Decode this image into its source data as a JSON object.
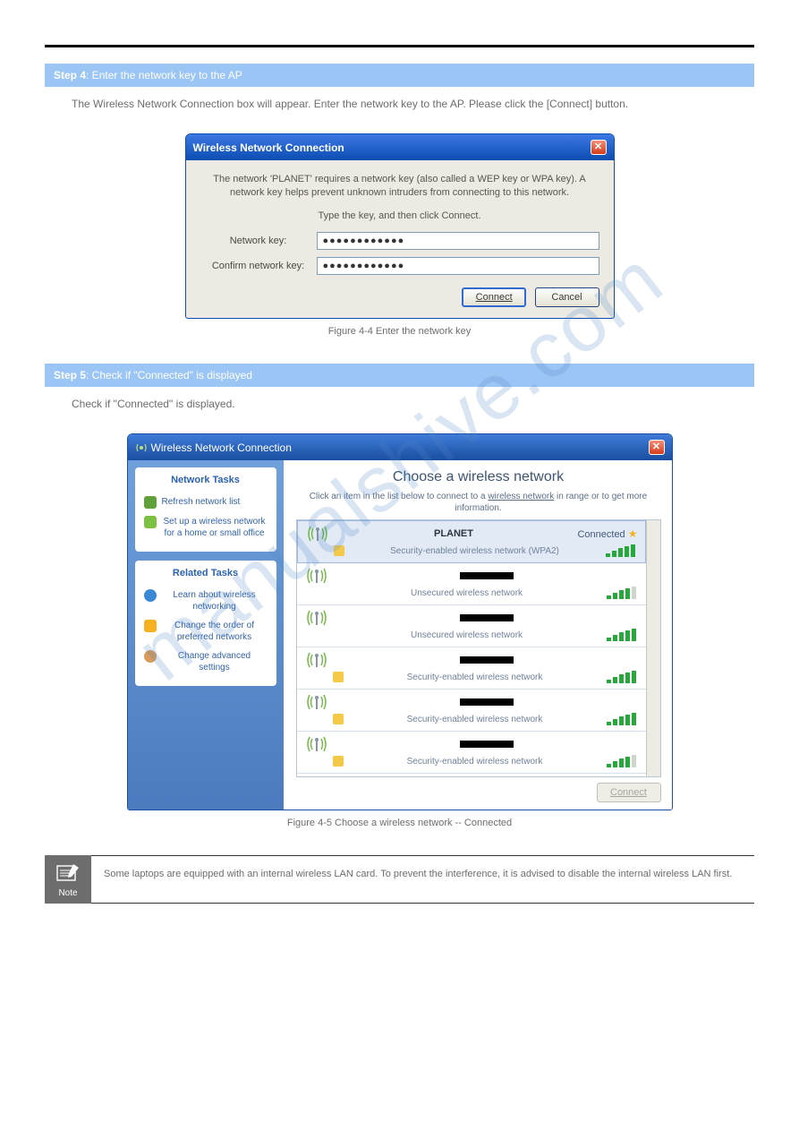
{
  "watermark": "manualshive.com",
  "step4": {
    "header_strong": "Step 4",
    "header_rest": ": Enter the network key to the AP",
    "body": "The Wireless Network Connection box will appear. Enter the network key to the AP. Please click the [Connect] button."
  },
  "fig1_caption": "Figure 4-4 Enter the network key",
  "step5": {
    "header_strong": "Step 5",
    "header_rest": ": Check if \"Connected\" is displayed",
    "body": "Check if \"Connected\" is displayed."
  },
  "fig2_caption": "Figure 4-5 Choose a wireless network -- Connected",
  "dialog1": {
    "title": "Wireless Network Connection",
    "intro1": "The network 'PLANET' requires a network key (also called a WEP key or WPA key). A network key helps prevent unknown intruders from connecting to this network.",
    "intro2": "Type the key, and then click Connect.",
    "lbl_key": "Network key:",
    "lbl_confirm": "Confirm network key:",
    "val_key": "●●●●●●●●●●●●",
    "val_confirm": "●●●●●●●●●●●●",
    "btn_connect": "Connect",
    "btn_cancel": "Cancel"
  },
  "dialog2": {
    "title": "Wireless Network Connection",
    "sidebar": {
      "tasks_title": "Network Tasks",
      "refresh": "Refresh network list",
      "setup": "Set up a wireless network for a home or small office",
      "related_title": "Related Tasks",
      "learn": "Learn about wireless networking",
      "order": "Change the order of preferred networks",
      "advanced": "Change advanced settings"
    },
    "main": {
      "heading": "Choose a wireless network",
      "hint_pre": "Click an item in the list below to connect to a ",
      "hint_link": "wireless network",
      "hint_post": " in range or to get more information.",
      "btn_connect": "Connect"
    },
    "networks": [
      {
        "ssid": "PLANET",
        "security": "Security-enabled wireless network (WPA2)",
        "locked": true,
        "status": "Connected",
        "selected": true,
        "weak": false,
        "blackout": false
      },
      {
        "ssid": "",
        "security": "Unsecured wireless network",
        "locked": false,
        "status": "",
        "selected": false,
        "weak": true,
        "blackout": true
      },
      {
        "ssid": "",
        "security": "Unsecured wireless network",
        "locked": false,
        "status": "",
        "selected": false,
        "weak": false,
        "blackout": true
      },
      {
        "ssid": "",
        "security": "Security-enabled wireless network",
        "locked": true,
        "status": "",
        "selected": false,
        "weak": false,
        "blackout": true
      },
      {
        "ssid": "",
        "security": "Security-enabled wireless network",
        "locked": true,
        "status": "",
        "selected": false,
        "weak": false,
        "blackout": true
      },
      {
        "ssid": "",
        "security": "Security-enabled wireless network",
        "locked": true,
        "status": "",
        "selected": false,
        "weak": true,
        "blackout": true
      }
    ]
  },
  "note": {
    "label": "Note",
    "text": "Some laptops are equipped with an internal wireless LAN card. To prevent the interference, it is advised to disable the internal wireless LAN first."
  }
}
